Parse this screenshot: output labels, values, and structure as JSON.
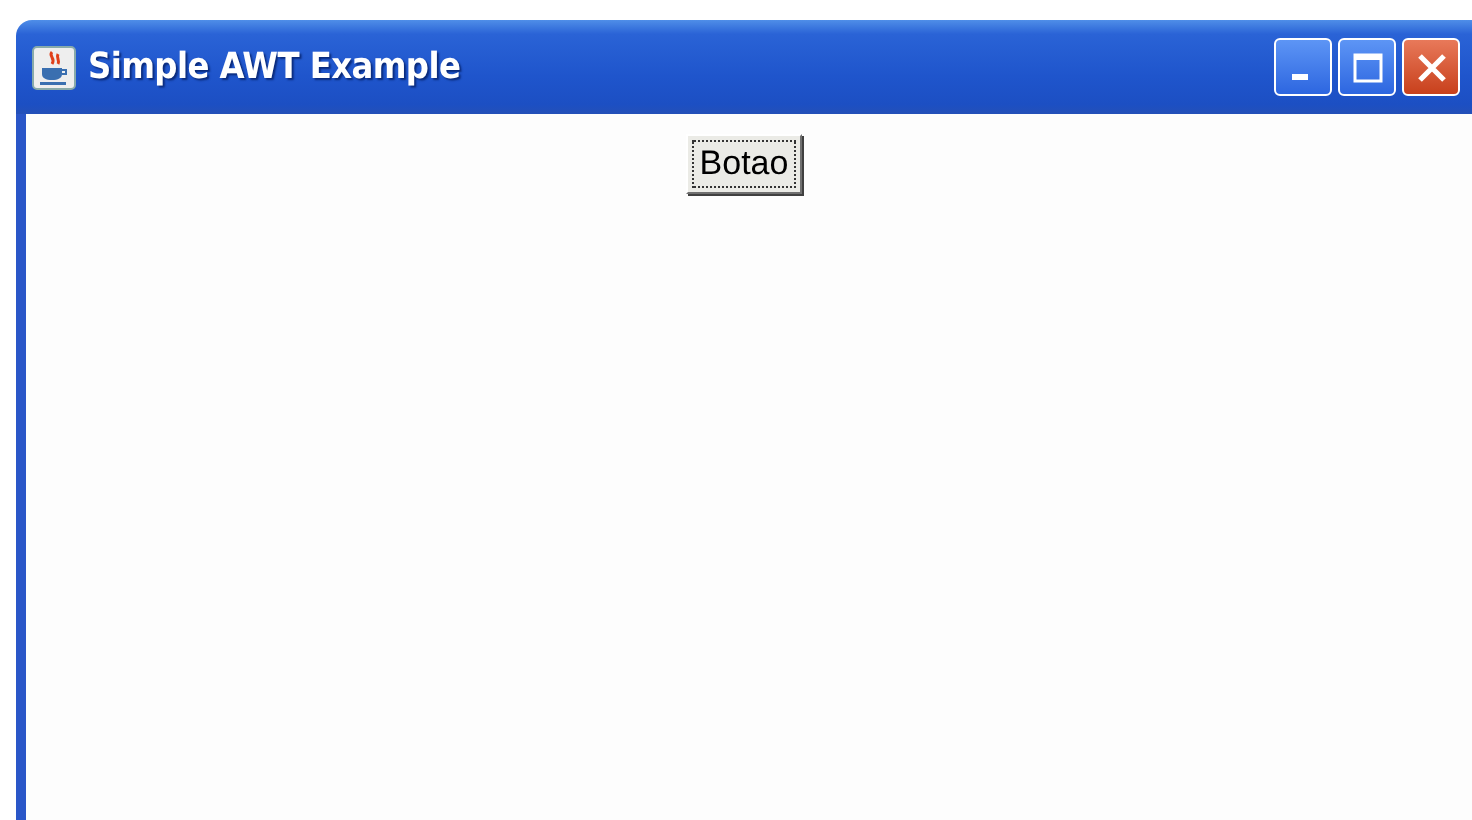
{
  "window": {
    "title": "Simple AWT Example"
  },
  "content": {
    "button": {
      "label": "Botao",
      "focused": true
    }
  }
}
